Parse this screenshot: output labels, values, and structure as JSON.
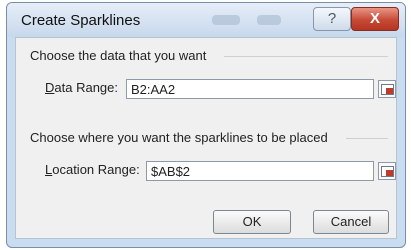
{
  "dialog": {
    "title": "Create Sparklines",
    "help_glyph": "?",
    "close_glyph": "X"
  },
  "data_section": {
    "heading": "Choose the data that you want",
    "field_label_accel": "D",
    "field_label_rest": "ata Range:",
    "value": "B2:AA2"
  },
  "location_section": {
    "heading": "Choose where you want the sparklines to be placed",
    "field_label_accel": "L",
    "field_label_rest": "ocation Range:",
    "value": "$AB$2"
  },
  "buttons": {
    "ok_label": "OK",
    "cancel_label": "Cancel"
  }
}
